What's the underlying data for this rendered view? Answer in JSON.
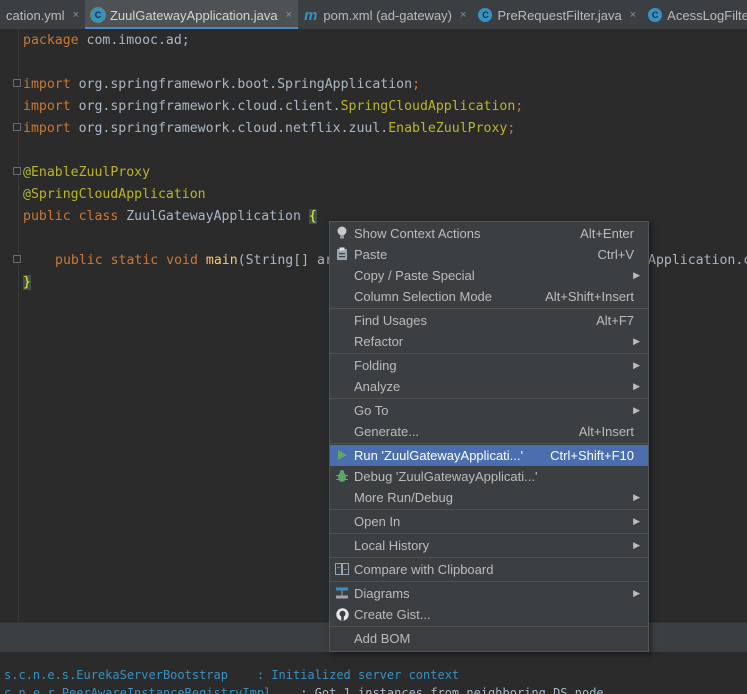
{
  "tabs": [
    {
      "label": "cation.yml",
      "icon": "yml-icon",
      "active": false
    },
    {
      "label": "ZuulGatewayApplication.java",
      "icon": "spring-class-icon",
      "active": true
    },
    {
      "label": "pom.xml (ad-gateway)",
      "icon": "maven-icon",
      "active": false
    },
    {
      "label": "PreRequestFilter.java",
      "icon": "class-icon",
      "active": false
    },
    {
      "label": "AcessLogFilter",
      "icon": "class-icon",
      "active": false
    }
  ],
  "tab_close_glyph": "×",
  "tab_glyphs": {
    "class": "C",
    "maven": "m"
  },
  "code": {
    "package_kw": "package",
    "package_name": " com.imooc.ad;",
    "import_kw": "import",
    "import1_a": " org.springframework.boot.",
    "import1_b": "SpringApplication",
    "import2_a": " org.springframework.cloud.client.",
    "import2_b": "SpringCloudApplication",
    "import3_a": " org.springframework.cloud.netflix.zuul.",
    "import3_b": "EnableZuulProxy",
    "semicolon": ";",
    "annotation1": "@EnableZuulProxy",
    "annotation2": "@SpringCloudApplication",
    "class_kw": "public class",
    "class_name": " ZuulGatewayApplication ",
    "open_brace": "{",
    "method_kw": "public static void",
    "method_name": "main",
    "method_args": "(String[] ar",
    "method_tail": "Application.c",
    "close_brace": "}"
  },
  "console": {
    "line1": "s.c.n.e.s.EurekaServerBootstrap    : Initialized server context",
    "line2_pkg": "c.n.e.r.PeerAwareInstanceRegistryImpl",
    "line2_msg": "    : Got 1 instances from neighboring DS node"
  },
  "menu": [
    {
      "label": "Show Context Actions",
      "shortcut": "Alt+Enter",
      "icon": "lightbulb-icon"
    },
    {
      "label": "Paste",
      "shortcut": "Ctrl+V",
      "icon": "clipboard-icon"
    },
    {
      "label": "Copy / Paste Special",
      "submenu": true
    },
    {
      "label": "Column Selection Mode",
      "shortcut": "Alt+Shift+Insert"
    },
    {
      "label": "Find Usages",
      "shortcut": "Alt+F7"
    },
    {
      "label": "Refactor",
      "submenu": true
    },
    {
      "label": "Folding",
      "submenu": true
    },
    {
      "label": "Analyze",
      "submenu": true
    },
    {
      "label": "Go To",
      "submenu": true
    },
    {
      "label": "Generate...",
      "shortcut": "Alt+Insert"
    },
    {
      "label": "Run 'ZuulGatewayApplicati...'",
      "shortcut": "Ctrl+Shift+F10",
      "icon": "run-icon",
      "selected": true
    },
    {
      "label": "Debug 'ZuulGatewayApplicati...'",
      "icon": "debug-icon"
    },
    {
      "label": "More Run/Debug",
      "submenu": true
    },
    {
      "label": "Open In",
      "submenu": true
    },
    {
      "label": "Local History",
      "submenu": true
    },
    {
      "label": "Compare with Clipboard",
      "icon": "compare-icon"
    },
    {
      "label": "Diagrams",
      "submenu": true,
      "icon": "diagram-icon"
    },
    {
      "label": "Create Gist...",
      "icon": "github-icon"
    },
    {
      "label": "Add BOM"
    }
  ],
  "submenu_glyph": "▶",
  "colors": {
    "background": "#2b2b2b",
    "keyword": "#cc7832",
    "annotation": "#bbb529",
    "selection": "#4b6eaf",
    "menu_bg": "#3c3f41"
  }
}
